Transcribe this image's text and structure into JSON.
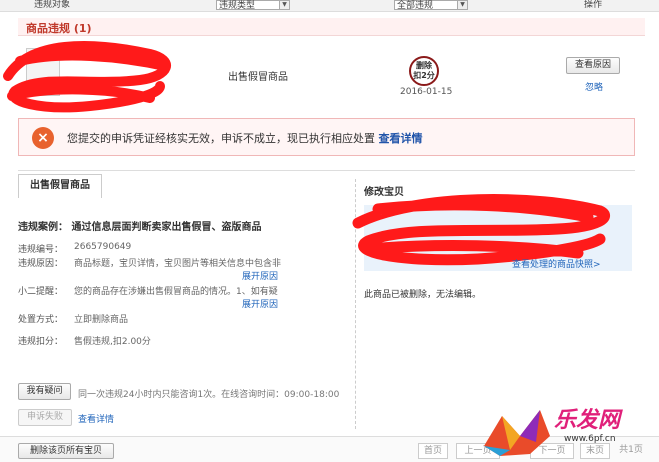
{
  "table_header": {
    "col_target": "违规对象",
    "filter_type": "违规类型",
    "filter_all": "全部违规",
    "col_action": "操作"
  },
  "group": {
    "title": "商品违规 (1)"
  },
  "row": {
    "violation_type": "出售假冒商品",
    "stamp_line1": "删除",
    "stamp_line2": "扣2分",
    "date": "2016-01-15",
    "view_reason": "查看原因",
    "ignore": "忽略"
  },
  "alert": {
    "message": "您提交的申诉凭证经核实无效，申诉不成立，现已执行相应处置",
    "link": "查看详情"
  },
  "detail": {
    "tab": "出售假冒商品",
    "case_label": "违规案例：",
    "case_value": "通过信息层面判断卖家出售假冒、盗版商品",
    "fields": [
      {
        "label": "违规编号：",
        "value": "2665790649"
      },
      {
        "label": "违规原因：",
        "value": "商品标题，宝贝详情，宝贝图片等相关信息中包含非"
      },
      {
        "label": "小二提醒：",
        "value": "您的商品存在涉嫌出售假冒商品的情况。1、如有疑"
      },
      {
        "label": "处置方式：",
        "value": "立即删除商品"
      },
      {
        "label": "违规扣分：",
        "value": "售假违规,扣2.00分"
      }
    ],
    "expand": "展开原因",
    "appeal_button": "我有疑问",
    "appeal_note": "同一次违规24小时内只能咨询1次。在线咨询时间：09:00-18:00",
    "fail_button": "申诉失败",
    "detail_link": "查看详情"
  },
  "edit": {
    "title": "修改宝贝",
    "link": "查看处理的商品快照>",
    "note": "此商品已被删除，无法编辑。"
  },
  "footer": {
    "delete_all": "删除该页所有宝贝",
    "pager": [
      "首页",
      "上一页",
      "下一页",
      "末页",
      "共1页"
    ]
  },
  "watermark": {
    "brand": "乐发网",
    "url": "www.6pf.cn"
  },
  "colors": {
    "accent_red": "#c0392b",
    "link_blue": "#2266bb",
    "alert_bg": "#fff5f5",
    "error_icon": "#e8622e"
  }
}
